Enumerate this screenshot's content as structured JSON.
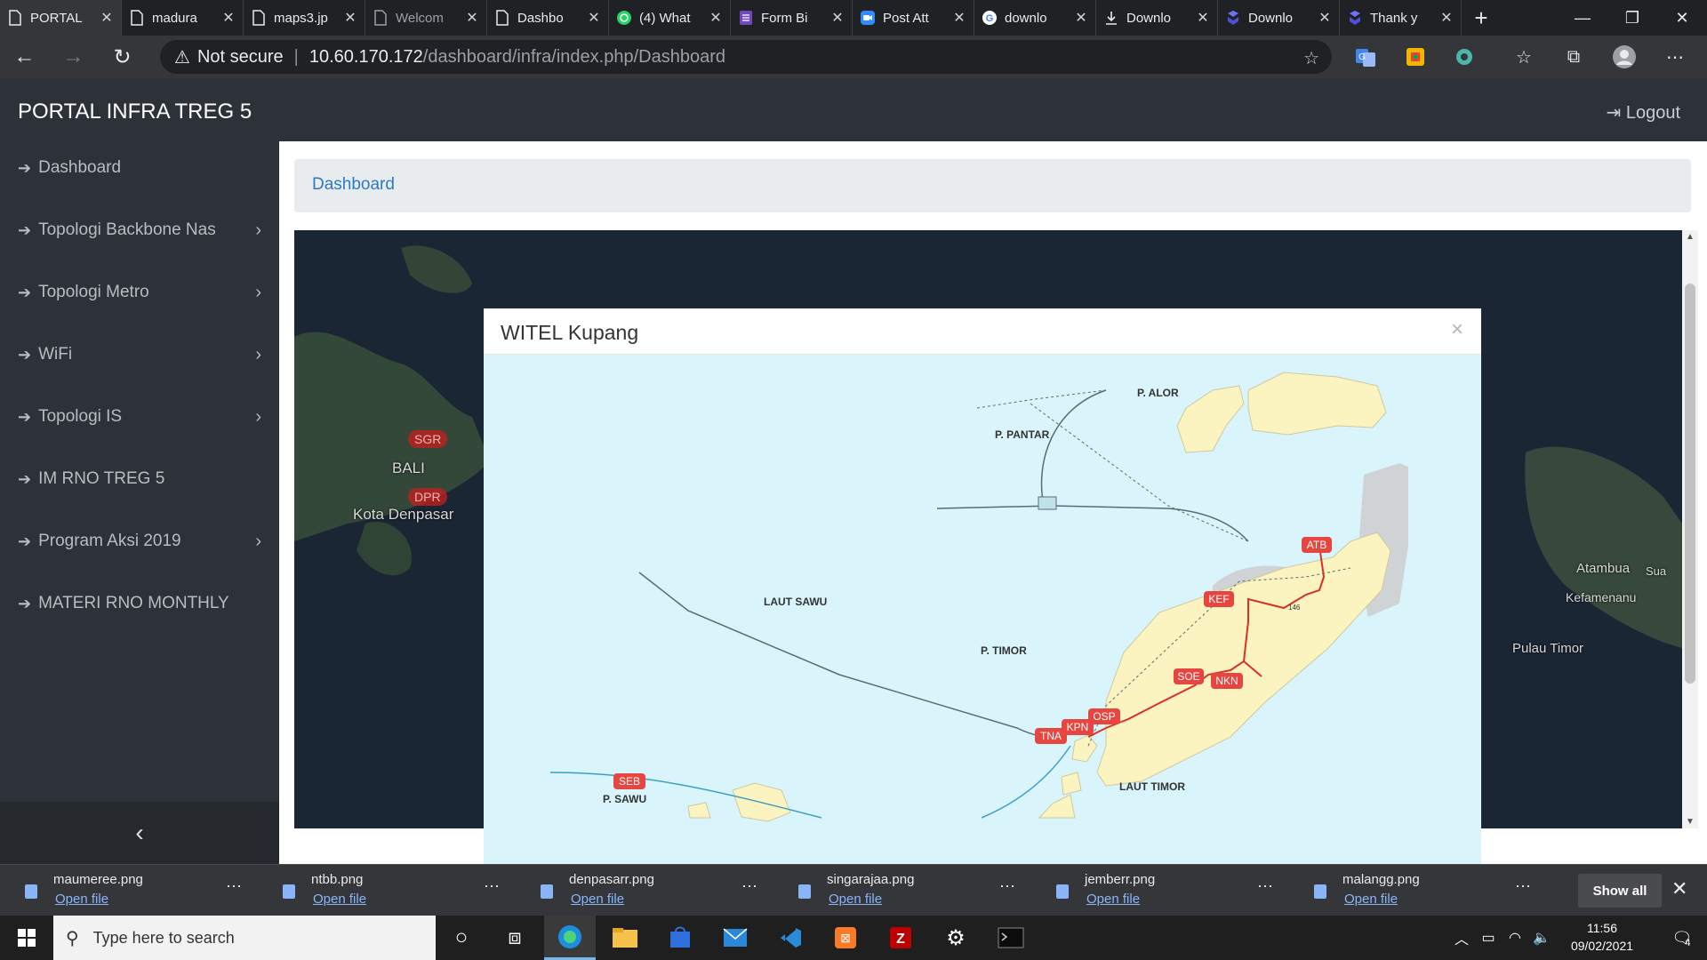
{
  "browser": {
    "tabs": [
      {
        "title": "PORTAL",
        "icon": "page-icon",
        "active": true
      },
      {
        "title": "madura",
        "icon": "page-icon"
      },
      {
        "title": "maps3.jp",
        "icon": "page-icon"
      },
      {
        "title": "Welcom",
        "icon": "page-icon"
      },
      {
        "title": "Dashbo",
        "icon": "page-icon"
      },
      {
        "title": "(4) What",
        "icon": "whatsapp-icon"
      },
      {
        "title": "Form Bi",
        "icon": "forms-icon"
      },
      {
        "title": "Post Att",
        "icon": "zoom-icon"
      },
      {
        "title": "downlo",
        "icon": "google-icon"
      },
      {
        "title": "Downlo",
        "icon": "download-icon"
      },
      {
        "title": "Downlo",
        "icon": "app-icon"
      },
      {
        "title": "Thank y",
        "icon": "app-icon"
      }
    ],
    "address": {
      "security": "Not secure",
      "host": "10.60.170.172",
      "path": "/dashboard/infra/index.php/Dashboard"
    }
  },
  "app": {
    "brand": "PORTAL INFRA TREG 5",
    "logout": "Logout",
    "sidebar": [
      {
        "label": "Dashboard",
        "has_children": false
      },
      {
        "label": "Topologi Backbone Nas",
        "has_children": true
      },
      {
        "label": "Topologi Metro",
        "has_children": true
      },
      {
        "label": "WiFi",
        "has_children": true
      },
      {
        "label": "Topologi IS",
        "has_children": true
      },
      {
        "label": "IM RNO TREG 5",
        "has_children": false
      },
      {
        "label": "Program Aksi 2019",
        "has_children": true
      },
      {
        "label": "MATERI RNO MONTHLY",
        "has_children": false
      }
    ],
    "breadcrumb": "Dashboard",
    "background_map": {
      "labels": [
        "BALI",
        "Kota Denpasar",
        "Atambua",
        "Kefamenanu",
        "Pulau Timor",
        "Sua"
      ],
      "pins": [
        "SGR",
        "DPR"
      ]
    },
    "modal": {
      "title": "WITEL Kupang",
      "close": "×",
      "map_labels": [
        "P. ALOR",
        "P. PANTAR",
        "LAUT SAWU",
        "P. TIMOR",
        "LAUT TIMOR",
        "P. SAWU",
        "146"
      ],
      "sites": [
        "ATB",
        "KEF",
        "SOE",
        "NKN",
        "OSP",
        "KPN",
        "TNA",
        "SEB"
      ],
      "colors": {
        "sea": "#d9f4fb",
        "land": "#fbf4c0",
        "site": "#e7453f",
        "route": "#d93025",
        "neighbor": "#d0d3d6"
      }
    }
  },
  "downloads": {
    "items": [
      {
        "name": "maumeree.png",
        "action": "Open file"
      },
      {
        "name": "ntbb.png",
        "action": "Open file"
      },
      {
        "name": "denpasarr.png",
        "action": "Open file"
      },
      {
        "name": "singarajaa.png",
        "action": "Open file"
      },
      {
        "name": "jemberr.png",
        "action": "Open file"
      },
      {
        "name": "malangg.png",
        "action": "Open file"
      }
    ],
    "show_all": "Show all"
  },
  "taskbar": {
    "search_placeholder": "Type here to search",
    "time": "11:56",
    "date": "09/02/2021",
    "notifications": "4"
  }
}
